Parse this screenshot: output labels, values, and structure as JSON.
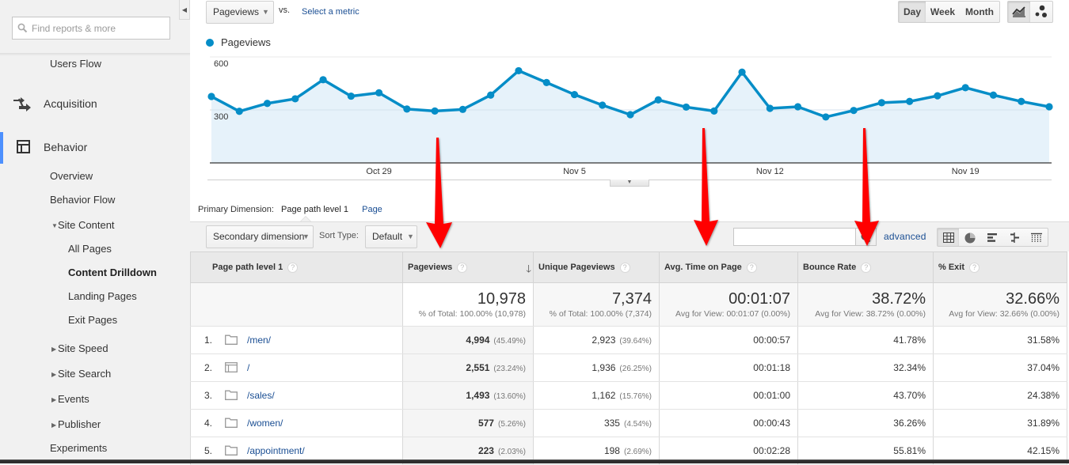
{
  "colors": {
    "accent": "#058dc7",
    "link": "#1a4e93",
    "active_nav": "#4d90fe",
    "annotation": "#ff0000"
  },
  "sidebar": {
    "search": {
      "placeholder": "Find reports & more",
      "value": "",
      "icon": "search-icon"
    },
    "collapse_icon": "caret-left-icon",
    "items": [
      {
        "label": "Users Flow"
      },
      {
        "label": "Acquisition",
        "icon": "acquisition-arrows-icon"
      },
      {
        "label": "Behavior",
        "icon": "behavior-layout-icon",
        "active": true
      },
      {
        "label": "Overview"
      },
      {
        "label": "Behavior Flow"
      },
      {
        "label": "Site Content",
        "expanded": true
      },
      {
        "label": "All Pages"
      },
      {
        "label": "Content Drilldown",
        "selected": true
      },
      {
        "label": "Landing Pages"
      },
      {
        "label": "Exit Pages"
      },
      {
        "label": "Site Speed",
        "expanded": false
      },
      {
        "label": "Site Search",
        "expanded": false
      },
      {
        "label": "Events",
        "expanded": false
      },
      {
        "label": "Publisher",
        "expanded": false
      },
      {
        "label": "Experiments"
      }
    ]
  },
  "chart_controls": {
    "metric": "Pageviews",
    "vs": "vs.",
    "compare_link": "Select a metric",
    "granularity": [
      "Day",
      "Week",
      "Month"
    ],
    "granularity_selected": "Day",
    "chart_types": [
      {
        "icon": "line-chart-icon",
        "selected": true
      },
      {
        "icon": "motion-chart-icon",
        "selected": false
      }
    ]
  },
  "chart_data": {
    "type": "area",
    "title": "",
    "legend": [
      {
        "name": "Pageviews",
        "color": "#058dc7"
      }
    ],
    "legend_position": "top-left",
    "series": [
      {
        "name": "Pageviews",
        "values": [
          376,
          292,
          337,
          363,
          471,
          378,
          397,
          305,
          294,
          303,
          384,
          522,
          455,
          387,
          327,
          273,
          357,
          316,
          294,
          514,
          309,
          318,
          260,
          297,
          341,
          348,
          380,
          426,
          384,
          348,
          318
        ]
      }
    ],
    "x_ticks": [
      {
        "index": 6,
        "label": "Oct 29"
      },
      {
        "index": 13,
        "label": "Nov 5"
      },
      {
        "index": 20,
        "label": "Nov 12"
      },
      {
        "index": 27,
        "label": "Nov 19"
      }
    ],
    "y_ticks": [
      300,
      600
    ],
    "ylim": [
      0,
      600
    ],
    "xlabel": "",
    "ylabel": "",
    "grid": true
  },
  "dimension_bar": {
    "label": "Primary Dimension:",
    "selected": "Page path level 1",
    "other": "Page"
  },
  "toolbar": {
    "secondary_dimension": "Secondary dimension",
    "sort_label": "Sort Type:",
    "sort_value": "Default",
    "search_value": "",
    "advanced": "advanced",
    "views": [
      {
        "icon": "table-grid-icon",
        "selected": true
      },
      {
        "icon": "pie-chart-icon",
        "selected": false
      },
      {
        "icon": "performance-bars-icon",
        "selected": false
      },
      {
        "icon": "comparison-icon",
        "selected": false
      },
      {
        "icon": "pivot-icon",
        "selected": false
      }
    ]
  },
  "table": {
    "columns": [
      "Page path level 1",
      "Pageviews",
      "Unique Pageviews",
      "Avg. Time on Page",
      "Bounce Rate",
      "% Exit"
    ],
    "sorted_column": "Pageviews",
    "summary": {
      "pageviews": "10,978",
      "pageviews_sub": "% of Total: 100.00% (10,978)",
      "unique": "7,374",
      "unique_sub": "% of Total: 100.00% (7,374)",
      "avg_time": "00:01:07",
      "avg_time_sub": "Avg for View: 00:01:07 (0.00%)",
      "bounce": "38.72%",
      "bounce_sub": "Avg for View: 38.72% (0.00%)",
      "exit": "32.66%",
      "exit_sub": "Avg for View: 32.66% (0.00%)"
    },
    "rows": [
      {
        "rank": "1.",
        "icon": "folder-icon",
        "page": "/men/",
        "pageviews": "4,994",
        "pageviews_pct": "(45.49%)",
        "unique": "2,923",
        "unique_pct": "(39.64%)",
        "avg_time": "00:00:57",
        "bounce": "41.78%",
        "exit": "31.58%"
      },
      {
        "rank": "2.",
        "icon": "page-icon",
        "page": "/",
        "pageviews": "2,551",
        "pageviews_pct": "(23.24%)",
        "unique": "1,936",
        "unique_pct": "(26.25%)",
        "avg_time": "00:01:18",
        "bounce": "32.34%",
        "exit": "37.04%"
      },
      {
        "rank": "3.",
        "icon": "folder-icon",
        "page": "/sales/",
        "pageviews": "1,493",
        "pageviews_pct": "(13.60%)",
        "unique": "1,162",
        "unique_pct": "(15.76%)",
        "avg_time": "00:01:00",
        "bounce": "43.70%",
        "exit": "24.38%"
      },
      {
        "rank": "4.",
        "icon": "folder-icon",
        "page": "/women/",
        "pageviews": "577",
        "pageviews_pct": "(5.26%)",
        "unique": "335",
        "unique_pct": "(4.54%)",
        "avg_time": "00:00:43",
        "bounce": "36.26%",
        "exit": "31.89%"
      },
      {
        "rank": "5.",
        "icon": "folder-icon",
        "page": "/appointment/",
        "pageviews": "223",
        "pageviews_pct": "(2.03%)",
        "unique": "198",
        "unique_pct": "(2.69%)",
        "avg_time": "00:02:28",
        "bounce": "55.81%",
        "exit": "42.15%"
      }
    ]
  },
  "annotations": [
    {
      "type": "arrow",
      "color": "#ff0000",
      "points_to": "Pageviews"
    },
    {
      "type": "arrow",
      "color": "#ff0000",
      "points_to": "Avg. Time on Page"
    },
    {
      "type": "arrow",
      "color": "#ff0000",
      "points_to": "Bounce Rate"
    }
  ]
}
